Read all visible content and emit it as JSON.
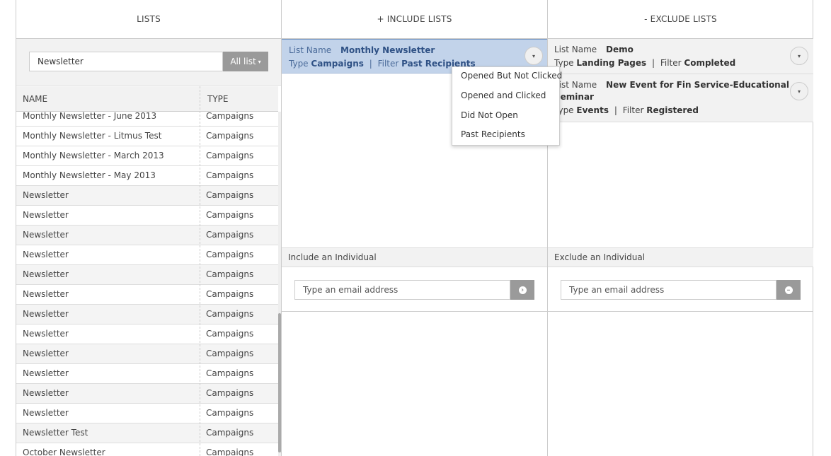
{
  "columns": {
    "lists": "LISTS",
    "include": "+ INCLUDE LISTS",
    "exclude": "- EXCLUDE LISTS"
  },
  "search": {
    "value": "Newsletter",
    "filter_button": "All list",
    "filter_caret": "▾"
  },
  "table": {
    "headers": {
      "name": "NAME",
      "type": "TYPE"
    },
    "rows": [
      {
        "name": "Monthly Newsletter - June 2013",
        "type": "Campaigns"
      },
      {
        "name": "Monthly Newsletter - Litmus Test",
        "type": "Campaigns"
      },
      {
        "name": "Monthly Newsletter - March 2013",
        "type": "Campaigns"
      },
      {
        "name": "Monthly Newsletter - May 2013",
        "type": "Campaigns"
      },
      {
        "name": "Newsletter",
        "type": "Campaigns"
      },
      {
        "name": "Newsletter",
        "type": "Campaigns"
      },
      {
        "name": "Newsletter",
        "type": "Campaigns"
      },
      {
        "name": "Newsletter",
        "type": "Campaigns"
      },
      {
        "name": "Newsletter",
        "type": "Campaigns"
      },
      {
        "name": "Newsletter",
        "type": "Campaigns"
      },
      {
        "name": "Newsletter",
        "type": "Campaigns"
      },
      {
        "name": "Newsletter",
        "type": "Campaigns"
      },
      {
        "name": "Newsletter",
        "type": "Campaigns"
      },
      {
        "name": "Newsletter",
        "type": "Campaigns"
      },
      {
        "name": "Newsletter",
        "type": "Campaigns"
      },
      {
        "name": "Newsletter",
        "type": "Campaigns"
      },
      {
        "name": "Newsletter Test",
        "type": "Campaigns"
      },
      {
        "name": "October Newsletter",
        "type": "Campaigns"
      }
    ]
  },
  "labels": {
    "list_name": "List Name",
    "type": "Type",
    "filter": "Filter",
    "separator": "|",
    "caret": "▾"
  },
  "include_items": [
    {
      "name": "Monthly Newsletter",
      "type": "Campaigns",
      "filter": "Past Recipients"
    }
  ],
  "exclude_items": [
    {
      "name": "Demo",
      "type": "Landing Pages",
      "filter": "Completed"
    },
    {
      "name_line1": "New Event for Fin Service-Educational",
      "name_line2": "Seminar",
      "type": "Events",
      "filter": "Registered"
    }
  ],
  "filter_menu": [
    "Opened But Not Clicked",
    "Opened and Clicked",
    "Did Not Open",
    "Past Recipients"
  ],
  "include_individual": {
    "title": "Include an Individual",
    "placeholder": "Type an email address",
    "button_glyph": "›"
  },
  "exclude_individual": {
    "title": "Exclude an Individual",
    "placeholder": "Type an email address",
    "button_glyph": "–"
  }
}
